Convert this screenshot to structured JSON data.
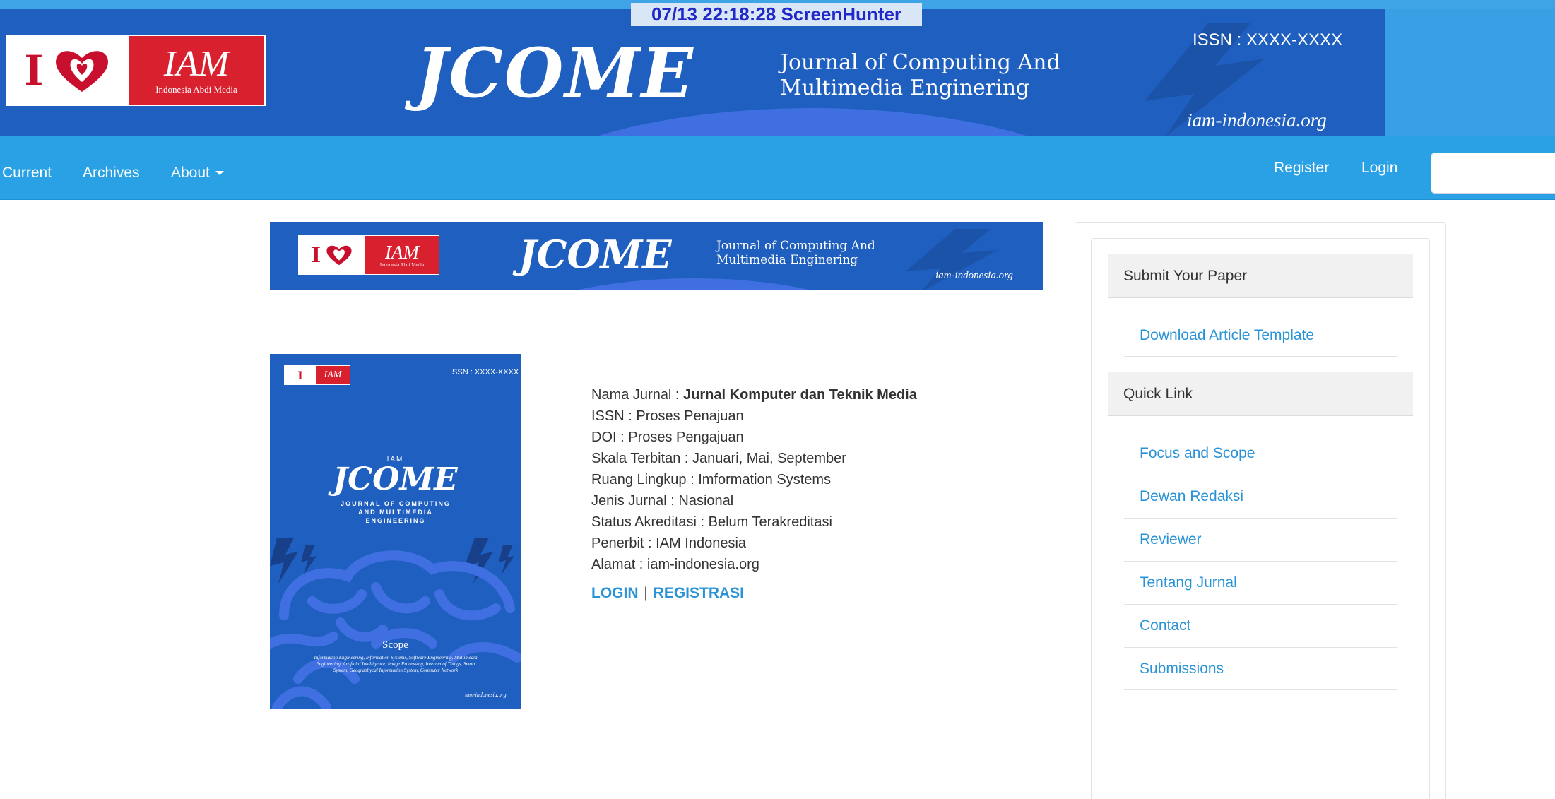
{
  "banner": {
    "logo_letter": "I",
    "logo_brand": "IAM",
    "logo_subtitle": "Indonesia Abdi Media",
    "title": "JCOME",
    "subtitle_line1": "Journal of Computing And",
    "subtitle_line2": "Multimedia Enginering",
    "issn": "ISSN : XXXX-XXXX",
    "site": "iam-indonesia.org",
    "screenhunter": "07/13  22:18:28  ScreenHunter"
  },
  "nav": {
    "current": "Current",
    "archives": "Archives",
    "about": "About",
    "register": "Register",
    "login": "Login",
    "search_placeholder": ""
  },
  "cover": {
    "logo_letter": "I",
    "logo_brand": "IAM",
    "issn": "ISSN : XXXX-XXXX",
    "iam": "IAM",
    "title": "JCOME",
    "subtitle": "JOURNAL OF COMPUTING AND MULTIMEDIA ENGINEERING",
    "scope_heading": "Scope",
    "scope_text": "Information Engineering, Information Systems, Software Engineering, Multimedia Engineering, Artificial Intelligence, Image Processing, Internet of Things, Smart System, Geographycal Information System, Computer Network",
    "site": "iam-indonesia.org"
  },
  "info": {
    "nama_label": "Nama Jurnal : ",
    "nama_value": "Jurnal Komputer dan Teknik Media",
    "issn": "ISSN : Proses Penajuan",
    "doi": "DOI : Proses Pengajuan",
    "skala": "Skala Terbitan : Januari, Mai, September",
    "ruang": "Ruang Lingkup : Imformation Systems",
    "jenis": "Jenis Jurnal : Nasional",
    "status": "Status Akreditasi : Belum Terakreditasi",
    "penerbit": "Penerbit : IAM Indonesia",
    "alamat": "Alamat : iam-indonesia.org",
    "login_link": "LOGIN",
    "separator": "|",
    "registrasi_link": "REGISTRASI"
  },
  "sidebar": {
    "submit_heading": "Submit Your Paper",
    "submit_links": [
      {
        "label": "Download Article Template"
      }
    ],
    "quick_heading": "Quick Link",
    "quick_links": [
      {
        "label": "Focus and Scope"
      },
      {
        "label": "Dewan Redaksi"
      },
      {
        "label": "Reviewer"
      },
      {
        "label": "Tentang Jurnal"
      },
      {
        "label": "Contact"
      },
      {
        "label": "Submissions"
      }
    ]
  },
  "colors": {
    "navbar": "#2aa1e4",
    "banner": "#1f5fbf",
    "link": "#2a93d5",
    "logo_red": "#d8202f"
  }
}
